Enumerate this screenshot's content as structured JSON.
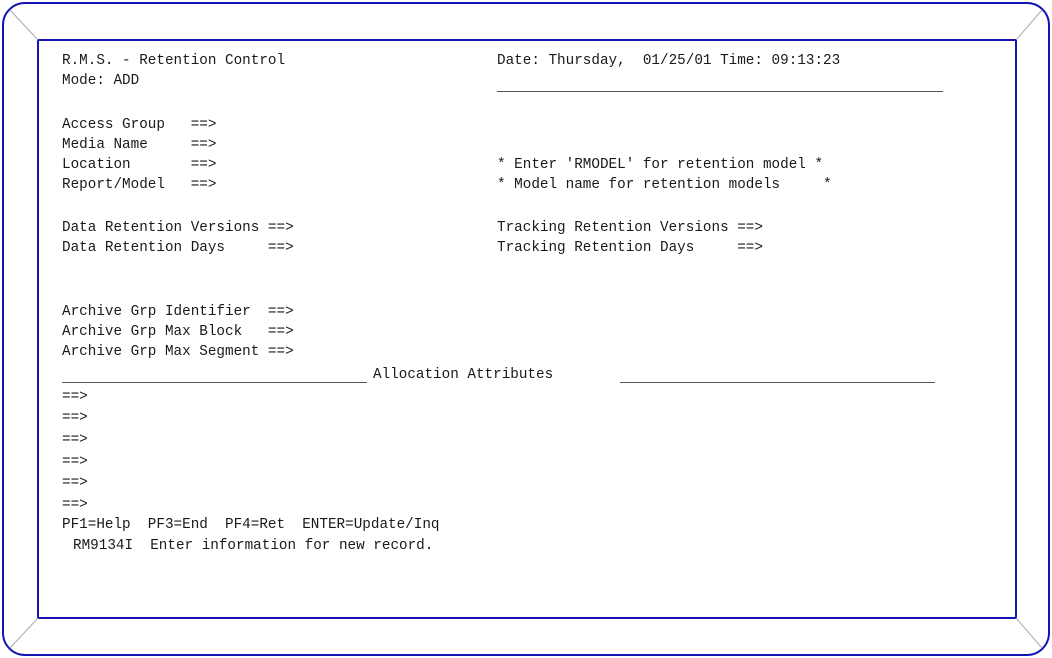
{
  "header": {
    "title": "R.M.S. - Retention Control",
    "datetime": "Date: Thursday,  01/25/01 Time: 09:13:23",
    "mode": "Mode: ADD"
  },
  "fields": {
    "access_group": "Access Group   ==>",
    "media_name": "Media Name     ==>",
    "location": "Location       ==>",
    "report_model": "Report/Model   ==>",
    "data_ret_versions": "Data Retention Versions ==>",
    "data_ret_days": "Data Retention Days     ==>",
    "track_ret_versions": "Tracking Retention Versions ==>",
    "track_ret_days": "Tracking Retention Days     ==>",
    "archive_id": "Archive Grp Identifier  ==>",
    "archive_max_block": "Archive Grp Max Block   ==>",
    "archive_max_segment": "Archive Grp Max Segment ==>"
  },
  "hints": {
    "line1": "* Enter 'RMODEL' for retention model *",
    "line2": "* Model name for retention models     *"
  },
  "allocation": {
    "title": "Allocation Attributes",
    "arrow": "==>"
  },
  "footer": {
    "pf_keys": "PF1=Help  PF3=End  PF4=Ret  ENTER=Update/Inq",
    "message": "RM9134I  Enter information for new record."
  },
  "colors": {
    "frame": "#1414b4",
    "text": "#1a1a1a"
  }
}
